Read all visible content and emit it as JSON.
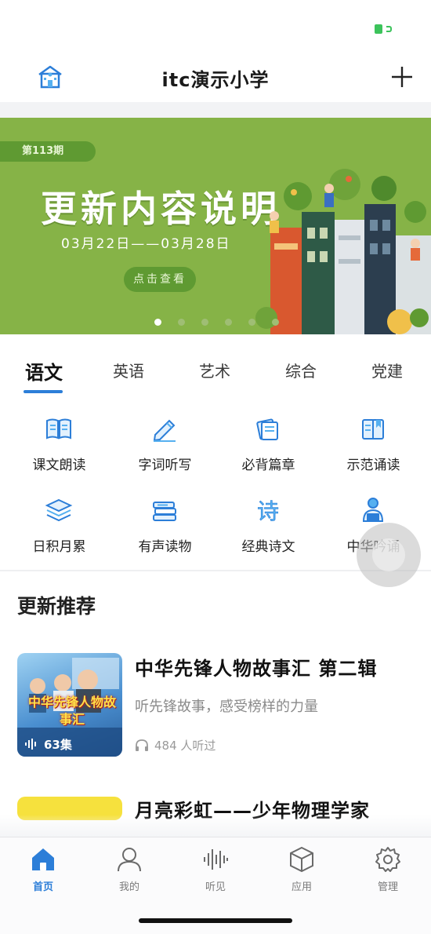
{
  "header": {
    "title": "itc演示小学"
  },
  "banner": {
    "issue_badge": "第113期",
    "headline": "更新内容说明",
    "date_range": "03月22日——03月28日",
    "cta": "点击查看",
    "slides_total": 6,
    "active_slide": 1
  },
  "tabs": [
    {
      "label": "语文",
      "active": true
    },
    {
      "label": "英语"
    },
    {
      "label": "艺术"
    },
    {
      "label": "综合"
    },
    {
      "label": "党建"
    }
  ],
  "grid": [
    {
      "label": "课文朗读",
      "icon": "book-open-icon"
    },
    {
      "label": "字词听写",
      "icon": "pencil-icon"
    },
    {
      "label": "必背篇章",
      "icon": "books-icon"
    },
    {
      "label": "示范诵读",
      "icon": "book-bookmark-icon"
    },
    {
      "label": "日积月累",
      "icon": "layers-icon"
    },
    {
      "label": "有声读物",
      "icon": "book-stack-icon"
    },
    {
      "label": "经典诗文",
      "icon": "poem-icon"
    },
    {
      "label": "中华吟诵",
      "icon": "reciter-icon"
    }
  ],
  "recommended": {
    "section_title": "更新推荐",
    "items": [
      {
        "title": "中华先锋人物故事汇 第二辑",
        "description": "听先锋故事，感受榜样的力量",
        "listeners": "484 人听过",
        "cover_title": "中华先锋人物故事汇",
        "episodes": "63集"
      },
      {
        "title": "月亮彩虹——少年物理学家"
      }
    ]
  },
  "tabbar": [
    {
      "label": "首页",
      "icon": "home-icon",
      "active": true
    },
    {
      "label": "我的",
      "icon": "user-icon"
    },
    {
      "label": "听见",
      "icon": "audio-wave-icon"
    },
    {
      "label": "应用",
      "icon": "cube-icon"
    },
    {
      "label": "管理",
      "icon": "gear-icon"
    }
  ],
  "colors": {
    "accent": "#2c7ed8",
    "banner_bg": "#86b347",
    "banner_accent": "#5f9a32"
  }
}
